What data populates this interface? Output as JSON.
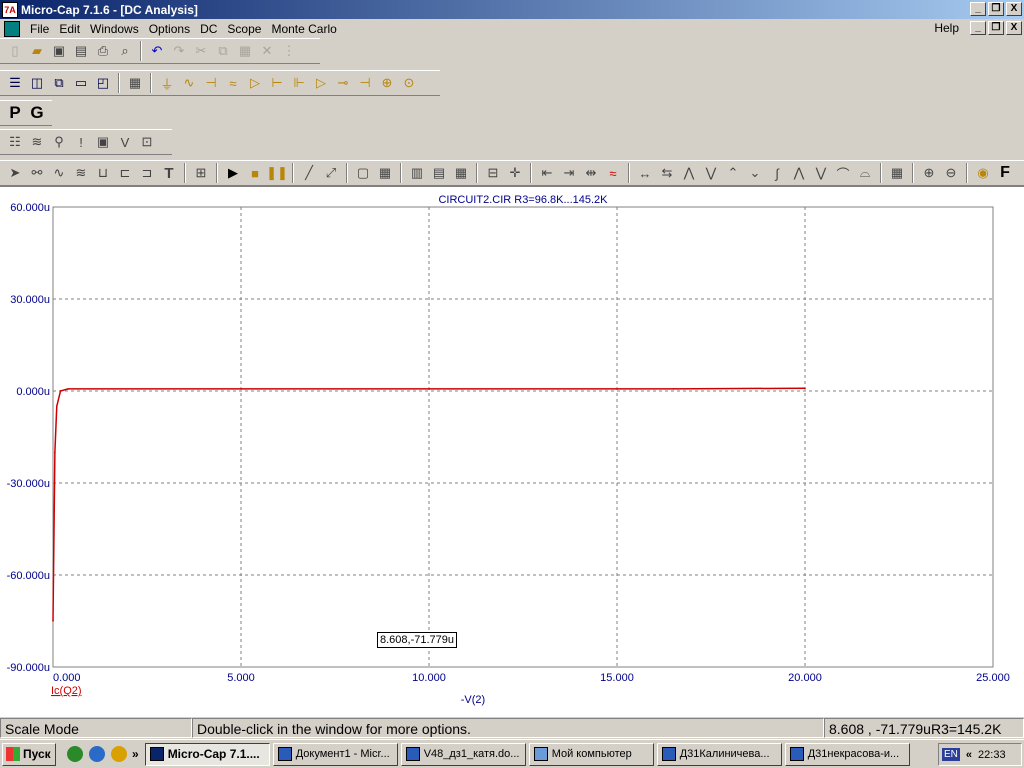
{
  "window": {
    "title": "Micro-Cap 7.1.6 - [DC Analysis]",
    "app_icon_text": "7A",
    "buttons": [
      "_",
      "❐",
      "X"
    ]
  },
  "menu": {
    "items": [
      "File",
      "Edit",
      "Windows",
      "Options",
      "DC",
      "Scope",
      "Monte Carlo"
    ],
    "help": "Help"
  },
  "toolbar_pg": {
    "p": "P",
    "g": "G"
  },
  "plot": {
    "title": "CIRCUIT2.CIR R3=96.8K...145.2K",
    "y_ticks": [
      "60.000u",
      "30.000u",
      "0.000u",
      "-30.000u",
      "-60.000u",
      "-90.000u"
    ],
    "x_ticks": [
      "0.000",
      "5.000",
      "10.000",
      "15.000",
      "20.000",
      "25.000"
    ],
    "xlabel": "-V(2)",
    "ylabel": "Ic(Q2)",
    "coord_readout": "8.608,-71.779u",
    "trace_color": "#cc0000"
  },
  "chart_data": {
    "type": "line",
    "title": "CIRCUIT2.CIR R3=96.8K...145.2K",
    "xlabel": "-V(2)",
    "ylabel": "",
    "xlim": [
      0,
      25
    ],
    "ylim": [
      -90,
      60
    ],
    "grid": true,
    "series": [
      {
        "name": "Ic(Q2)",
        "x": [
          0,
          0.05,
          0.1,
          0.2,
          0.4,
          16.5,
          20
        ],
        "y": [
          -75,
          -20,
          -5,
          0,
          0.7,
          0.7,
          0.9
        ]
      }
    ]
  },
  "status": {
    "mode": "Scale Mode",
    "hint": "Double-click in the window for more options.",
    "readout": "8.608 , -71.779uR3=145.2K"
  },
  "taskbar": {
    "start": "Пуск",
    "tasks": [
      {
        "label": "Micro-Cap 7.1....",
        "active": true
      },
      {
        "label": "Документ1 - Micr...",
        "active": false
      },
      {
        "label": "V48_дз1_катя.do...",
        "active": false
      },
      {
        "label": "Мой компьютер",
        "active": false
      },
      {
        "label": "Д31Калиничева...",
        "active": false
      },
      {
        "label": "Д31некрасова-и...",
        "active": false
      }
    ],
    "lang": "EN",
    "chevron": "«",
    "time": "22:33",
    "chevron_left": "»"
  }
}
